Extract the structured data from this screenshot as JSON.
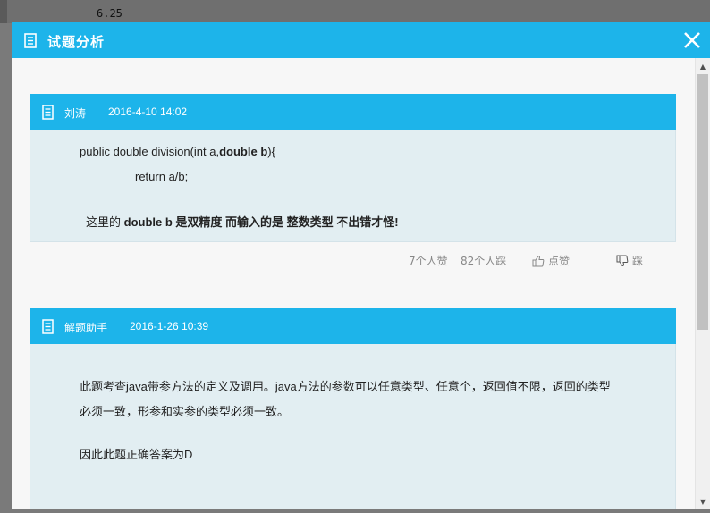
{
  "background": {
    "number": "6.25"
  },
  "dialog": {
    "title": "试题分析",
    "title_icon": "document-icon",
    "close_icon": "close-icon"
  },
  "comments": [
    {
      "author": "刘涛",
      "time": "2016-4-10 14:02",
      "code_line1_pre": "public double division(int a,",
      "code_line1_bold": "double b",
      "code_line1_post": "){",
      "code_line2": "return a/b;",
      "note_pre": "这里的 ",
      "note_bold": "double b  是双精度 而输入的是 整数类型  不出错才怪!",
      "likes_text": "7个人赞",
      "dislikes_text": "82个人踩",
      "like_button": "点赞",
      "dislike_button": "踩"
    },
    {
      "author": "解题助手",
      "time": "2016-1-26 10:39",
      "para1_line1": "此题考查java带参方法的定义及调用。java方法的参数可以任意类型、任意个，返回值不限，返回的类型",
      "para1_line2": "必须一致，形参和实参的类型必须一致。",
      "para2": "因此此题正确答案为D"
    }
  ],
  "colors": {
    "header": "#1db4ea",
    "card_body": "#e2eef2",
    "dialog_bg": "#f7f7f7"
  }
}
